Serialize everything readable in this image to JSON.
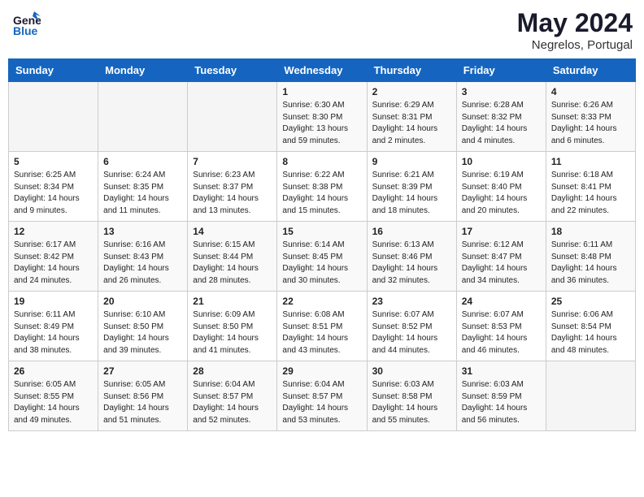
{
  "header": {
    "logo_line1": "General",
    "logo_line2": "Blue",
    "main_title": "May 2024",
    "subtitle": "Negrelos, Portugal"
  },
  "weekdays": [
    "Sunday",
    "Monday",
    "Tuesday",
    "Wednesday",
    "Thursday",
    "Friday",
    "Saturday"
  ],
  "weeks": [
    [
      {
        "day": "",
        "sunrise": "",
        "sunset": "",
        "daylight": ""
      },
      {
        "day": "",
        "sunrise": "",
        "sunset": "",
        "daylight": ""
      },
      {
        "day": "",
        "sunrise": "",
        "sunset": "",
        "daylight": ""
      },
      {
        "day": "1",
        "sunrise": "Sunrise: 6:30 AM",
        "sunset": "Sunset: 8:30 PM",
        "daylight": "Daylight: 13 hours and 59 minutes."
      },
      {
        "day": "2",
        "sunrise": "Sunrise: 6:29 AM",
        "sunset": "Sunset: 8:31 PM",
        "daylight": "Daylight: 14 hours and 2 minutes."
      },
      {
        "day": "3",
        "sunrise": "Sunrise: 6:28 AM",
        "sunset": "Sunset: 8:32 PM",
        "daylight": "Daylight: 14 hours and 4 minutes."
      },
      {
        "day": "4",
        "sunrise": "Sunrise: 6:26 AM",
        "sunset": "Sunset: 8:33 PM",
        "daylight": "Daylight: 14 hours and 6 minutes."
      }
    ],
    [
      {
        "day": "5",
        "sunrise": "Sunrise: 6:25 AM",
        "sunset": "Sunset: 8:34 PM",
        "daylight": "Daylight: 14 hours and 9 minutes."
      },
      {
        "day": "6",
        "sunrise": "Sunrise: 6:24 AM",
        "sunset": "Sunset: 8:35 PM",
        "daylight": "Daylight: 14 hours and 11 minutes."
      },
      {
        "day": "7",
        "sunrise": "Sunrise: 6:23 AM",
        "sunset": "Sunset: 8:37 PM",
        "daylight": "Daylight: 14 hours and 13 minutes."
      },
      {
        "day": "8",
        "sunrise": "Sunrise: 6:22 AM",
        "sunset": "Sunset: 8:38 PM",
        "daylight": "Daylight: 14 hours and 15 minutes."
      },
      {
        "day": "9",
        "sunrise": "Sunrise: 6:21 AM",
        "sunset": "Sunset: 8:39 PM",
        "daylight": "Daylight: 14 hours and 18 minutes."
      },
      {
        "day": "10",
        "sunrise": "Sunrise: 6:19 AM",
        "sunset": "Sunset: 8:40 PM",
        "daylight": "Daylight: 14 hours and 20 minutes."
      },
      {
        "day": "11",
        "sunrise": "Sunrise: 6:18 AM",
        "sunset": "Sunset: 8:41 PM",
        "daylight": "Daylight: 14 hours and 22 minutes."
      }
    ],
    [
      {
        "day": "12",
        "sunrise": "Sunrise: 6:17 AM",
        "sunset": "Sunset: 8:42 PM",
        "daylight": "Daylight: 14 hours and 24 minutes."
      },
      {
        "day": "13",
        "sunrise": "Sunrise: 6:16 AM",
        "sunset": "Sunset: 8:43 PM",
        "daylight": "Daylight: 14 hours and 26 minutes."
      },
      {
        "day": "14",
        "sunrise": "Sunrise: 6:15 AM",
        "sunset": "Sunset: 8:44 PM",
        "daylight": "Daylight: 14 hours and 28 minutes."
      },
      {
        "day": "15",
        "sunrise": "Sunrise: 6:14 AM",
        "sunset": "Sunset: 8:45 PM",
        "daylight": "Daylight: 14 hours and 30 minutes."
      },
      {
        "day": "16",
        "sunrise": "Sunrise: 6:13 AM",
        "sunset": "Sunset: 8:46 PM",
        "daylight": "Daylight: 14 hours and 32 minutes."
      },
      {
        "day": "17",
        "sunrise": "Sunrise: 6:12 AM",
        "sunset": "Sunset: 8:47 PM",
        "daylight": "Daylight: 14 hours and 34 minutes."
      },
      {
        "day": "18",
        "sunrise": "Sunrise: 6:11 AM",
        "sunset": "Sunset: 8:48 PM",
        "daylight": "Daylight: 14 hours and 36 minutes."
      }
    ],
    [
      {
        "day": "19",
        "sunrise": "Sunrise: 6:11 AM",
        "sunset": "Sunset: 8:49 PM",
        "daylight": "Daylight: 14 hours and 38 minutes."
      },
      {
        "day": "20",
        "sunrise": "Sunrise: 6:10 AM",
        "sunset": "Sunset: 8:50 PM",
        "daylight": "Daylight: 14 hours and 39 minutes."
      },
      {
        "day": "21",
        "sunrise": "Sunrise: 6:09 AM",
        "sunset": "Sunset: 8:50 PM",
        "daylight": "Daylight: 14 hours and 41 minutes."
      },
      {
        "day": "22",
        "sunrise": "Sunrise: 6:08 AM",
        "sunset": "Sunset: 8:51 PM",
        "daylight": "Daylight: 14 hours and 43 minutes."
      },
      {
        "day": "23",
        "sunrise": "Sunrise: 6:07 AM",
        "sunset": "Sunset: 8:52 PM",
        "daylight": "Daylight: 14 hours and 44 minutes."
      },
      {
        "day": "24",
        "sunrise": "Sunrise: 6:07 AM",
        "sunset": "Sunset: 8:53 PM",
        "daylight": "Daylight: 14 hours and 46 minutes."
      },
      {
        "day": "25",
        "sunrise": "Sunrise: 6:06 AM",
        "sunset": "Sunset: 8:54 PM",
        "daylight": "Daylight: 14 hours and 48 minutes."
      }
    ],
    [
      {
        "day": "26",
        "sunrise": "Sunrise: 6:05 AM",
        "sunset": "Sunset: 8:55 PM",
        "daylight": "Daylight: 14 hours and 49 minutes."
      },
      {
        "day": "27",
        "sunrise": "Sunrise: 6:05 AM",
        "sunset": "Sunset: 8:56 PM",
        "daylight": "Daylight: 14 hours and 51 minutes."
      },
      {
        "day": "28",
        "sunrise": "Sunrise: 6:04 AM",
        "sunset": "Sunset: 8:57 PM",
        "daylight": "Daylight: 14 hours and 52 minutes."
      },
      {
        "day": "29",
        "sunrise": "Sunrise: 6:04 AM",
        "sunset": "Sunset: 8:57 PM",
        "daylight": "Daylight: 14 hours and 53 minutes."
      },
      {
        "day": "30",
        "sunrise": "Sunrise: 6:03 AM",
        "sunset": "Sunset: 8:58 PM",
        "daylight": "Daylight: 14 hours and 55 minutes."
      },
      {
        "day": "31",
        "sunrise": "Sunrise: 6:03 AM",
        "sunset": "Sunset: 8:59 PM",
        "daylight": "Daylight: 14 hours and 56 minutes."
      },
      {
        "day": "",
        "sunrise": "",
        "sunset": "",
        "daylight": ""
      }
    ]
  ]
}
